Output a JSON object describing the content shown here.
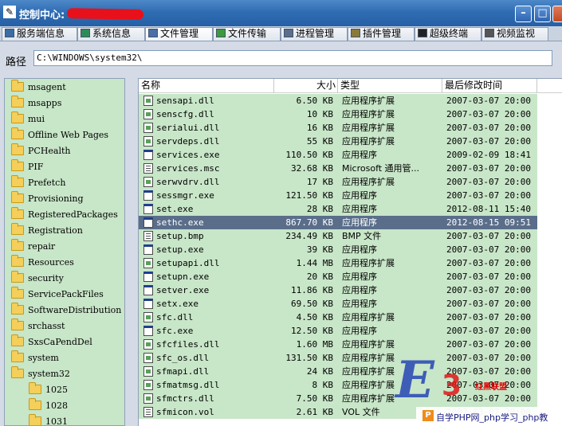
{
  "window": {
    "title": "控制中心:",
    "app_icon": "app-icon"
  },
  "tabs": [
    {
      "label": "服务端信息",
      "icon": "server-info-icon",
      "color": "#3a6ea5"
    },
    {
      "label": "系统信息",
      "icon": "system-info-icon",
      "color": "#2e8b57"
    },
    {
      "label": "文件管理",
      "icon": "file-manager-icon",
      "color": "#4a6fa8"
    },
    {
      "label": "文件传输",
      "icon": "file-transfer-icon",
      "color": "#3b9b3b"
    },
    {
      "label": "进程管理",
      "icon": "process-manager-icon",
      "color": "#5b6f8c"
    },
    {
      "label": "插件管理",
      "icon": "plugin-manager-icon",
      "color": "#8a7a3a"
    },
    {
      "label": "超级终端",
      "icon": "terminal-icon",
      "color": "#222222"
    },
    {
      "label": "视频监视",
      "icon": "video-monitor-icon",
      "color": "#555555"
    }
  ],
  "path": {
    "label": "路径",
    "value": "C:\\WINDOWS\\system32\\"
  },
  "tree": [
    {
      "label": "msagent",
      "indent": 0
    },
    {
      "label": "msapps",
      "indent": 0
    },
    {
      "label": "mui",
      "indent": 0
    },
    {
      "label": "Offline Web Pages",
      "indent": 0
    },
    {
      "label": "PCHealth",
      "indent": 0
    },
    {
      "label": "PIF",
      "indent": 0
    },
    {
      "label": "Prefetch",
      "indent": 0
    },
    {
      "label": "Provisioning",
      "indent": 0
    },
    {
      "label": "RegisteredPackages",
      "indent": 0
    },
    {
      "label": "Registration",
      "indent": 0
    },
    {
      "label": "repair",
      "indent": 0
    },
    {
      "label": "Resources",
      "indent": 0
    },
    {
      "label": "security",
      "indent": 0
    },
    {
      "label": "ServicePackFiles",
      "indent": 0
    },
    {
      "label": "SoftwareDistribution",
      "indent": 0
    },
    {
      "label": "srchasst",
      "indent": 0
    },
    {
      "label": "SxsCaPendDel",
      "indent": 0
    },
    {
      "label": "system",
      "indent": 0
    },
    {
      "label": "system32",
      "indent": 0
    },
    {
      "label": "1025",
      "indent": 1
    },
    {
      "label": "1028",
      "indent": 1
    },
    {
      "label": "1031",
      "indent": 1
    }
  ],
  "columns": {
    "name": "名称",
    "size": "大小",
    "type": "类型",
    "modified": "最后修改时间"
  },
  "files": [
    {
      "name": "sensapi.dll",
      "size": "6.50 KB",
      "type": "应用程序扩展",
      "modified": "2007-03-07 20:00",
      "icon": "dll"
    },
    {
      "name": "senscfg.dll",
      "size": "10 KB",
      "type": "应用程序扩展",
      "modified": "2007-03-07 20:00",
      "icon": "dll"
    },
    {
      "name": "serialui.dll",
      "size": "16 KB",
      "type": "应用程序扩展",
      "modified": "2007-03-07 20:00",
      "icon": "dll"
    },
    {
      "name": "servdeps.dll",
      "size": "55 KB",
      "type": "应用程序扩展",
      "modified": "2007-03-07 20:00",
      "icon": "dll"
    },
    {
      "name": "services.exe",
      "size": "110.50 KB",
      "type": "应用程序",
      "modified": "2009-02-09 18:41",
      "icon": "exe"
    },
    {
      "name": "services.msc",
      "size": "32.68 KB",
      "type": "Microsoft 通用管...",
      "modified": "2007-03-07 20:00",
      "icon": "doc"
    },
    {
      "name": "serwvdrv.dll",
      "size": "17 KB",
      "type": "应用程序扩展",
      "modified": "2007-03-07 20:00",
      "icon": "dll"
    },
    {
      "name": "sessmgr.exe",
      "size": "121.50 KB",
      "type": "应用程序",
      "modified": "2007-03-07 20:00",
      "icon": "exe"
    },
    {
      "name": "set.exe",
      "size": "28 KB",
      "type": "应用程序",
      "modified": "2012-08-11 15:40",
      "icon": "exe"
    },
    {
      "name": "sethc.exe",
      "size": "867.70 KB",
      "type": "应用程序",
      "modified": "2012-08-15 09:51",
      "icon": "exe",
      "selected": true
    },
    {
      "name": "setup.bmp",
      "size": "234.49 KB",
      "type": "BMP 文件",
      "modified": "2007-03-07 20:00",
      "icon": "doc"
    },
    {
      "name": "setup.exe",
      "size": "39 KB",
      "type": "应用程序",
      "modified": "2007-03-07 20:00",
      "icon": "exe"
    },
    {
      "name": "setupapi.dll",
      "size": "1.44 MB",
      "type": "应用程序扩展",
      "modified": "2007-03-07 20:00",
      "icon": "dll"
    },
    {
      "name": "setupn.exe",
      "size": "20 KB",
      "type": "应用程序",
      "modified": "2007-03-07 20:00",
      "icon": "exe"
    },
    {
      "name": "setver.exe",
      "size": "11.86 KB",
      "type": "应用程序",
      "modified": "2007-03-07 20:00",
      "icon": "exe"
    },
    {
      "name": "setx.exe",
      "size": "69.50 KB",
      "type": "应用程序",
      "modified": "2007-03-07 20:00",
      "icon": "exe"
    },
    {
      "name": "sfc.dll",
      "size": "4.50 KB",
      "type": "应用程序扩展",
      "modified": "2007-03-07 20:00",
      "icon": "dll"
    },
    {
      "name": "sfc.exe",
      "size": "12.50 KB",
      "type": "应用程序",
      "modified": "2007-03-07 20:00",
      "icon": "exe"
    },
    {
      "name": "sfcfiles.dll",
      "size": "1.60 MB",
      "type": "应用程序扩展",
      "modified": "2007-03-07 20:00",
      "icon": "dll"
    },
    {
      "name": "sfc_os.dll",
      "size": "131.50 KB",
      "type": "应用程序扩展",
      "modified": "2007-03-07 20:00",
      "icon": "dll"
    },
    {
      "name": "sfmapi.dll",
      "size": "24 KB",
      "type": "应用程序扩展",
      "modified": "2007-03-07 20:00",
      "icon": "dll"
    },
    {
      "name": "sfmatmsg.dll",
      "size": "8 KB",
      "type": "应用程序扩展",
      "modified": "2007-03-07 20:00",
      "icon": "dll"
    },
    {
      "name": "sfmctrs.dll",
      "size": "7.50 KB",
      "type": "应用程序扩展",
      "modified": "2007-03-07 20:00",
      "icon": "dll"
    },
    {
      "name": "sfmicon.vol",
      "size": "2.61 KB",
      "type": "VOL 文件",
      "modified": "2007-03-07 20:00",
      "icon": "doc"
    }
  ],
  "watermark": {
    "logo_letter": "E",
    "logo_number": "3",
    "logo_red_text": "红黑联盟",
    "badge": "P",
    "footer_text": "自学PHP网_php学习_php教"
  },
  "colors": {
    "title_bar": "#2f6db3",
    "row_green": "#c8e6c8",
    "row_selected": "#5a6e8a",
    "scribble_red": "#e8101a"
  }
}
